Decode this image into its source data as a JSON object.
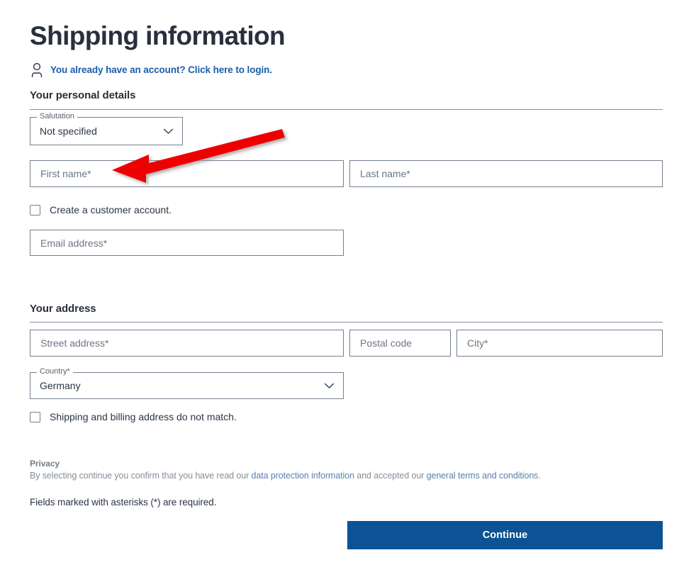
{
  "page": {
    "title": "Shipping information"
  },
  "login": {
    "icon": "person-icon",
    "text": "You already have an account? Click here to login."
  },
  "personal": {
    "heading": "Your personal details",
    "salutation": {
      "legend": "Salutation",
      "value": "Not specified",
      "icon": "chevron-down-icon"
    },
    "first_name_placeholder": "First name*",
    "last_name_placeholder": "Last name*",
    "create_account_label": "Create a customer account.",
    "email_placeholder": "Email address*"
  },
  "address": {
    "heading": "Your address",
    "street_placeholder": "Street address*",
    "postal_placeholder": "Postal code",
    "city_placeholder": "City*",
    "country": {
      "legend": "Country*",
      "value": "Germany",
      "icon": "chevron-down-icon"
    },
    "billing_mismatch_label": "Shipping and billing address do not match."
  },
  "privacy": {
    "title": "Privacy",
    "text_part1": "By selecting continue you confirm that you have read our ",
    "link1": "data protection information",
    "text_part2": " and accepted our ",
    "link2": "general terms and conditions",
    "text_part3": ".",
    "required_note": "Fields marked with asterisks (*) are required."
  },
  "actions": {
    "continue_label": "Continue"
  },
  "annotation": {
    "name": "red-arrow-pointing-to-first-name",
    "color": "#ee0000"
  },
  "colors": {
    "accent_blue": "#0b5394",
    "link_blue": "#1a5eaa",
    "border_grey": "#74808f",
    "text_dark": "#28303c",
    "muted_grey": "#878e99"
  }
}
